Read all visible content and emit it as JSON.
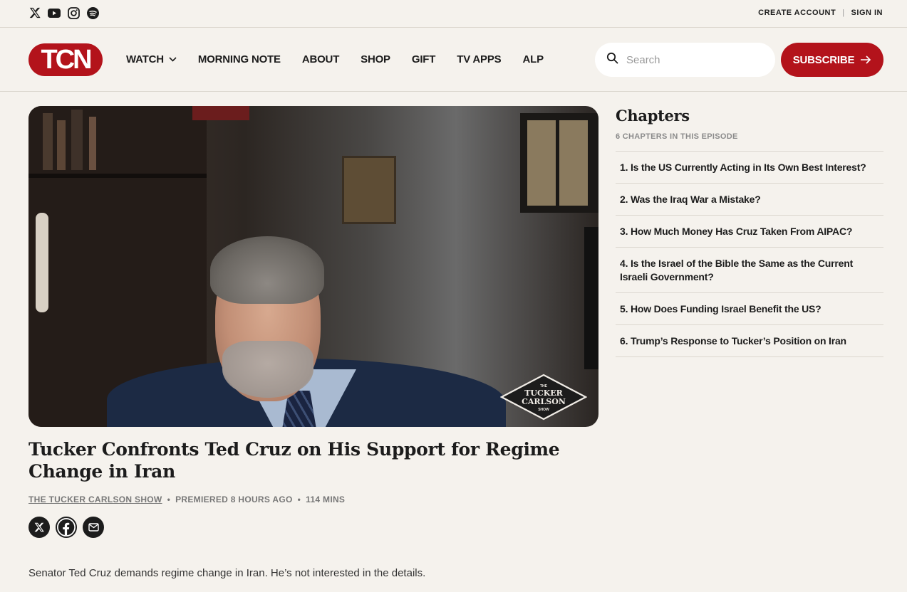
{
  "topbar": {
    "social": [
      "x-icon",
      "youtube-icon",
      "instagram-icon",
      "spotify-icon"
    ],
    "create_account": "CREATE ACCOUNT",
    "separator": "|",
    "sign_in": "SIGN IN"
  },
  "nav": {
    "logo": "TCN",
    "items": [
      "WATCH",
      "MORNING NOTE",
      "ABOUT",
      "SHOP",
      "GIFT",
      "TV APPS",
      "ALP"
    ],
    "search_placeholder": "Search",
    "subscribe": "SUBSCRIBE"
  },
  "video": {
    "watermark": [
      "THE",
      "TUCKER",
      "CARLSON",
      "SHOW"
    ]
  },
  "episode": {
    "title": "Tucker Confronts Ted Cruz on His Support for Regime Change in Iran",
    "show": "THE TUCKER CARLSON SHOW",
    "premiered": "PREMIERED 8 HOURS AGO",
    "duration": "114 MINS",
    "share": [
      "x-icon",
      "facebook-icon",
      "email-icon"
    ],
    "description": "Senator Ted Cruz demands regime change in Iran. He’s not interested in the details."
  },
  "chapters": {
    "heading": "Chapters",
    "count": "6 CHAPTERS IN THIS EPISODE",
    "items": [
      "1. Is the US Currently Acting in Its Own Best Interest?",
      "2. Was the Iraq War a Mistake?",
      "3. How Much Money Has Cruz Taken From AIPAC?",
      "4. Is the Israel of the Bible the Same as the Current Israeli Government?",
      "5. How Does Funding Israel Benefit the US?",
      "6. Trump’s Response to Tucker’s Position on Iran"
    ]
  },
  "colors": {
    "brand_red": "#b3131b",
    "background": "#f5f2ed",
    "text": "#1c1c1c"
  }
}
